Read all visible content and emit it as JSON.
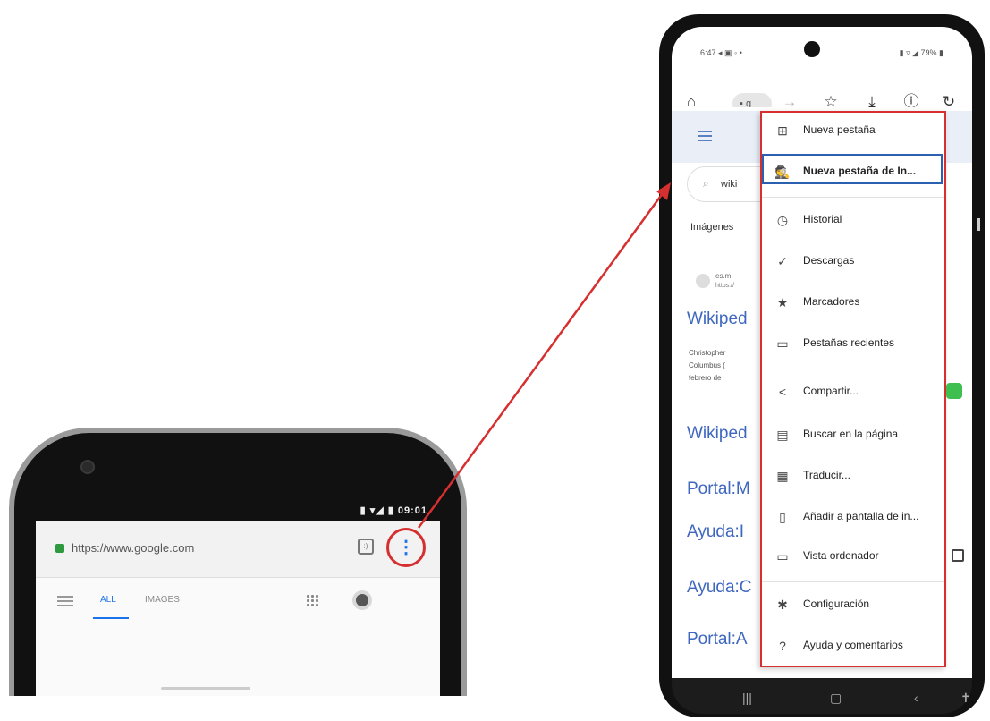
{
  "left_phone": {
    "status": "▮ ▾◢ ▮ 09:01",
    "url": "https://www.google.com",
    "tabs_count": ":)",
    "nav": {
      "all": "ALL",
      "images": "IMAGES"
    }
  },
  "right_phone": {
    "status_left": "6:47 ◂ ▣ ◦ •",
    "status_right": "▮ ▿ ◢ 79% ▮",
    "omnibox_text": "g",
    "page": {
      "search_text": "wiki",
      "images_label": "Imágenes",
      "site": "es.m.",
      "site_url": "https://",
      "links": [
        "Wikiped",
        "Wikiped",
        "Portal:M",
        "Ayuda:I",
        "Ayuda:C",
        "Portal:A"
      ],
      "snippets": [
        "Christopher",
        "Columbus (",
        "febrero de"
      ]
    },
    "menu": {
      "items": [
        {
          "label": "Nueva pestaña",
          "icon": "new-tab-icon"
        },
        {
          "label": "Nueva pestaña de In...",
          "icon": "incognito-icon"
        },
        {
          "label": "Historial",
          "icon": "history-icon"
        },
        {
          "label": "Descargas",
          "icon": "download-icon"
        },
        {
          "label": "Marcadores",
          "icon": "star-icon"
        },
        {
          "label": "Pestañas recientes",
          "icon": "devices-icon"
        },
        {
          "label": "Compartir...",
          "icon": "share-icon"
        },
        {
          "label": "Buscar en la página",
          "icon": "find-icon"
        },
        {
          "label": "Traducir...",
          "icon": "translate-icon"
        },
        {
          "label": "Añadir a pantalla de in...",
          "icon": "add-home-icon"
        },
        {
          "label": "Vista ordenador",
          "icon": "desktop-icon"
        },
        {
          "label": "Configuración",
          "icon": "gear-icon"
        },
        {
          "label": "Ayuda y comentarios",
          "icon": "help-icon"
        }
      ]
    }
  },
  "colors": {
    "highlight": "#d62f2f",
    "accent_blue": "#2b5fb0",
    "link": "#3f67c0"
  }
}
